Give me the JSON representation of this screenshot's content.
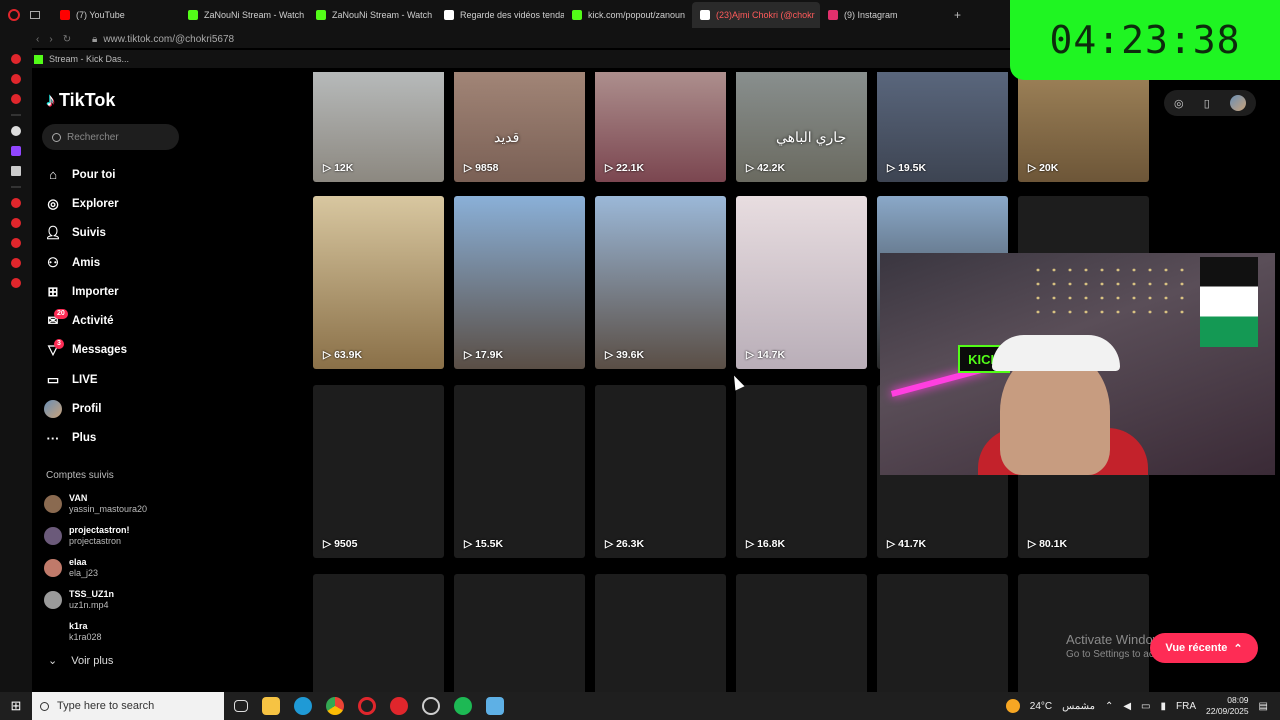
{
  "browser": {
    "tabs": [
      {
        "label": "(7) YouTube",
        "color": "#ff0000"
      },
      {
        "label": "ZaNouNi Stream - Watch",
        "color": "#53fc18"
      },
      {
        "label": "ZaNouNi Stream - Watch",
        "color": "#53fc18"
      },
      {
        "label": "Regarde des vidéos tendan",
        "color": "#ffffff"
      },
      {
        "label": "kick.com/popout/zanoun",
        "color": "#53fc18"
      },
      {
        "label": "(23)Ajmi Chokri (@chokr",
        "color": "#ffffff",
        "active": true
      },
      {
        "label": "(9) Instagram",
        "color": "#e1306c"
      }
    ],
    "url": "www.tiktok.com/@chokri5678",
    "bookmark": "Stream - Kick Das..."
  },
  "timer": "04:23:38",
  "tiktok": {
    "logo": "TikTok",
    "search_placeholder": "Rechercher",
    "nav": [
      {
        "label": "Pour toi",
        "icon": "home-icon"
      },
      {
        "label": "Explorer",
        "icon": "compass-icon"
      },
      {
        "label": "Suivis",
        "icon": "following-icon"
      },
      {
        "label": "Amis",
        "icon": "friends-icon"
      },
      {
        "label": "Importer",
        "icon": "upload-icon"
      },
      {
        "label": "Activité",
        "icon": "activity-icon",
        "badge": "20"
      },
      {
        "label": "Messages",
        "icon": "messages-icon",
        "badge": "3"
      },
      {
        "label": "LIVE",
        "icon": "live-icon"
      },
      {
        "label": "Profil",
        "icon": "avatar"
      },
      {
        "label": "Plus",
        "icon": "more-icon"
      }
    ],
    "following_title": "Comptes suivis",
    "following": [
      {
        "name": "VAN",
        "handle": "yassin_mastoura20",
        "color": "#8a6a50"
      },
      {
        "name": "projectastron!",
        "handle": "projectastron",
        "color": "#6b5a7a"
      },
      {
        "name": "elaa",
        "handle": "ela_j23",
        "color": "#c07a6a"
      },
      {
        "name": "TSS_UZ1n",
        "handle": "uz1n.mp4",
        "color": "#9a9a9a"
      },
      {
        "name": "k1ra",
        "handle": "k1ra028",
        "color": "#000000"
      }
    ],
    "see_more": "Voir plus",
    "videos": [
      {
        "views": "12K",
        "bg": "linear-gradient(180deg,#cfd6db,#8c8880)"
      },
      {
        "views": "9858",
        "bg": "linear-gradient(180deg,#b89a8a,#7a6055)",
        "caption": "قديد"
      },
      {
        "views": "22.1K",
        "bg": "linear-gradient(180deg,#c9b8b0,#7b4650)"
      },
      {
        "views": "42.2K",
        "bg": "linear-gradient(180deg,#9aa4a8,#6a6a60)",
        "caption": "جاري الباهي"
      },
      {
        "views": "19.5K",
        "bg": "linear-gradient(180deg,#6a7a95,#3d4452)"
      },
      {
        "views": "20K",
        "bg": "linear-gradient(180deg,#b89a6a,#6d5638)"
      },
      {
        "views": "63.9K",
        "bg": "linear-gradient(180deg,#d8c7a0,#8a7048)"
      },
      {
        "views": "17.9K",
        "bg": "linear-gradient(180deg,#8ab0d8,#5a4e45)"
      },
      {
        "views": "39.6K",
        "bg": "linear-gradient(180deg,#9bb8d8,#5a4e45)"
      },
      {
        "views": "14.7K",
        "bg": "linear-gradient(180deg,#e8dde0,#b9aeb8)"
      },
      {
        "views": "",
        "bg": "linear-gradient(180deg,#8aa8c8,#2a2a2a)"
      },
      {
        "views": "",
        "bg": "#1d1d1d"
      },
      {
        "views": "9505",
        "bg": "#1d1d1d"
      },
      {
        "views": "15.5K",
        "bg": "#1d1d1d"
      },
      {
        "views": "26.3K",
        "bg": "#1d1d1d"
      },
      {
        "views": "16.8K",
        "bg": "#1d1d1d"
      },
      {
        "views": "41.7K",
        "bg": "#1d1d1d"
      },
      {
        "views": "80.1K",
        "bg": "#1d1d1d"
      },
      {
        "views": "",
        "bg": "#1d1d1d"
      },
      {
        "views": "",
        "bg": "#1d1d1d"
      },
      {
        "views": "",
        "bg": "#1d1d1d"
      },
      {
        "views": "",
        "bg": "#1d1d1d"
      },
      {
        "views": "",
        "bg": "#1d1d1d"
      },
      {
        "views": "",
        "bg": "#1d1d1d"
      }
    ],
    "recent_button": "Vue récente",
    "accent": "#fe2c55"
  },
  "webcam": {
    "sign": "KICK"
  },
  "windows": {
    "activate_title": "Activate Windows",
    "activate_sub": "Go to Settings to activate Windows.",
    "search_placeholder": "Type here to search",
    "weather": "24°C",
    "weather_desc": "مشمس",
    "lang": "FRA",
    "time": "08:09",
    "date": "22/09/2025"
  }
}
